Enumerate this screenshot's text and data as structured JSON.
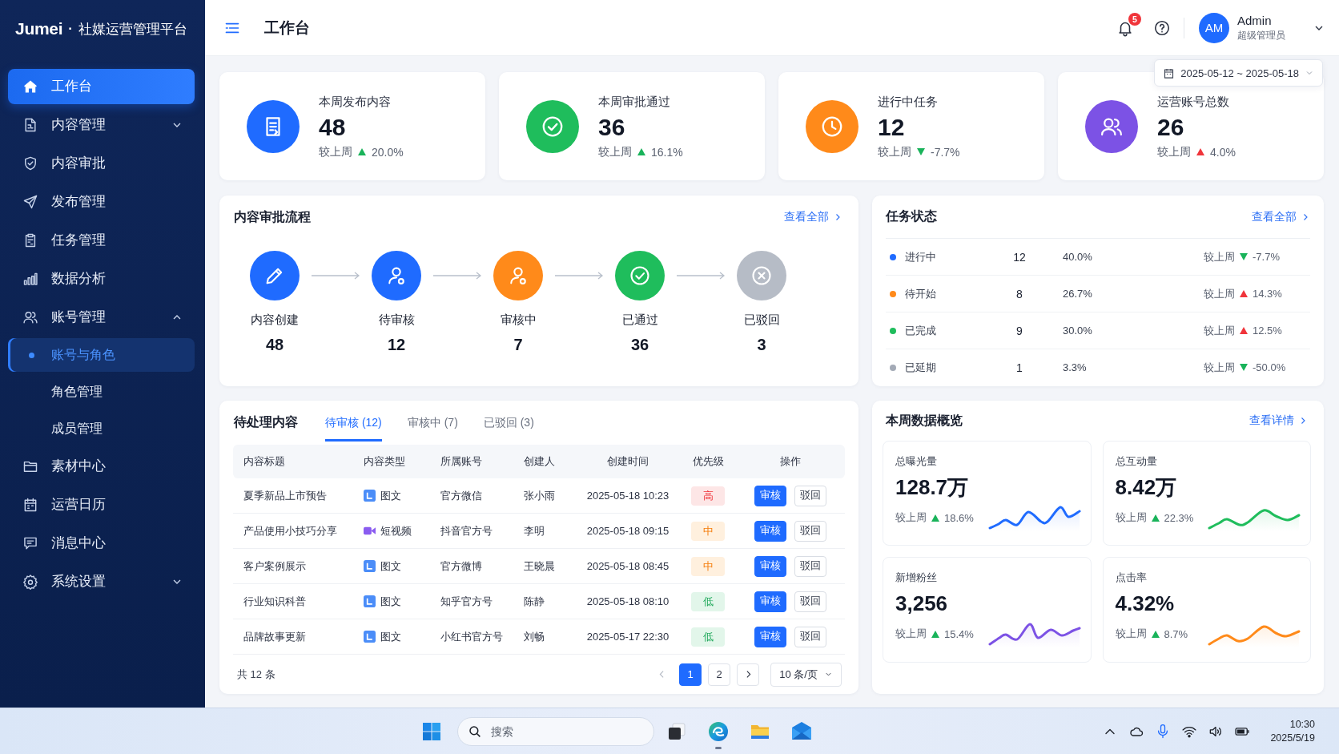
{
  "sidebar": {
    "brand": "Jumei",
    "separator": "·",
    "app_name": "社媒运营管理平台",
    "items": [
      {
        "label": "工作台",
        "selected": true
      },
      {
        "label": "内容管理",
        "selected": false,
        "expanded": false
      },
      {
        "label": "内容审批",
        "selected": false
      },
      {
        "label": "发布管理",
        "selected": false
      },
      {
        "label": "任务管理",
        "selected": false
      },
      {
        "label": "数据分析",
        "selected": false
      },
      {
        "label": "账号管理",
        "selected": false,
        "expanded": true,
        "children": [
          {
            "label": "账号与角色",
            "selected": true
          },
          {
            "label": "角色管理",
            "selected": false
          },
          {
            "label": "成员管理",
            "selected": false
          }
        ]
      },
      {
        "label": "素材中心",
        "selected": false
      },
      {
        "label": "运营日历",
        "selected": false
      },
      {
        "label": "消息中心",
        "selected": false
      },
      {
        "label": "系统设置",
        "selected": false,
        "expanded": false
      }
    ]
  },
  "header": {
    "title": "工作台",
    "notification_count": "5",
    "user": {
      "initials": "AM",
      "name": "Admin",
      "role": "超级管理员"
    }
  },
  "date_range": "2025-05-12 ~ 2025-05-18",
  "stats": [
    {
      "label": "本周发布内容",
      "value": "48",
      "compare_label": "较上周",
      "change": {
        "up": true,
        "color": "#19b35a",
        "text": "20.0%"
      },
      "color": "#1f6bff"
    },
    {
      "label": "本周审批通过",
      "value": "36",
      "compare_label": "较上周",
      "change": {
        "up": true,
        "color": "#19b35a",
        "text": "16.1%"
      },
      "color": "#1fbd5c"
    },
    {
      "label": "进行中任务",
      "value": "12",
      "compare_label": "较上周",
      "change": {
        "up": false,
        "color": "#19b35a",
        "text": "-7.7%"
      },
      "color": "#ff8a1a"
    },
    {
      "label": "运营账号总数",
      "value": "26",
      "compare_label": "较上周",
      "change": {
        "up": true,
        "color": "#f0353b",
        "text": "4.0%"
      },
      "color": "#7c52e5"
    }
  ],
  "approval_flow": {
    "title": "内容审批流程",
    "link": "查看全部",
    "steps": [
      {
        "label": "内容创建",
        "count": "48",
        "color": "#1f6bff"
      },
      {
        "label": "待审核",
        "count": "12",
        "color": "#1f6bff"
      },
      {
        "label": "审核中",
        "count": "7",
        "color": "#ff8a1a"
      },
      {
        "label": "已通过",
        "count": "36",
        "color": "#1fbd5c"
      },
      {
        "label": "已驳回",
        "count": "3",
        "color": "#b6bcc6"
      }
    ]
  },
  "task_status": {
    "title": "任务状态",
    "link": "查看全部",
    "rows": [
      {
        "label": "进行中",
        "color": "#1f6bff",
        "count": "12",
        "percent": "40.0%",
        "compare_label": "较上周",
        "change": {
          "up": false,
          "color": "#19b35a",
          "text": "-7.7%"
        }
      },
      {
        "label": "待开始",
        "color": "#ff8a1a",
        "count": "8",
        "percent": "26.7%",
        "compare_label": "较上周",
        "change": {
          "up": true,
          "color": "#f0353b",
          "text": "14.3%"
        }
      },
      {
        "label": "已完成",
        "color": "#1fbd5c",
        "count": "9",
        "percent": "30.0%",
        "compare_label": "较上周",
        "change": {
          "up": true,
          "color": "#f0353b",
          "text": "12.5%"
        }
      },
      {
        "label": "已延期",
        "color": "#a3aab6",
        "count": "1",
        "percent": "3.3%",
        "compare_label": "较上周",
        "change": {
          "up": false,
          "color": "#19b35a",
          "text": "-50.0%"
        }
      }
    ]
  },
  "pending_content": {
    "title": "待处理内容",
    "tabs": [
      {
        "label": "待审核 (12)",
        "selected": true
      },
      {
        "label": "审核中 (7)",
        "selected": false
      },
      {
        "label": "已驳回 (3)",
        "selected": false
      }
    ],
    "columns": [
      "内容标题",
      "内容类型",
      "所属账号",
      "创建人",
      "创建时间",
      "优先级",
      "操作"
    ],
    "rows": [
      {
        "title": "夏季新品上市预告",
        "type": {
          "kind": "article",
          "label": "图文"
        },
        "account": "官方微信",
        "creator": "张小雨",
        "created_at": "2025-05-18 10:23",
        "priority": {
          "label": "高",
          "kind": "high"
        },
        "actions": [
          {
            "label": "审核",
            "kind": "primary"
          },
          {
            "label": "驳回",
            "kind": "secondary"
          }
        ]
      },
      {
        "title": "产品使用小技巧分享",
        "type": {
          "kind": "video",
          "label": "短视频"
        },
        "account": "抖音官方号",
        "creator": "李明",
        "created_at": "2025-05-18 09:15",
        "priority": {
          "label": "中",
          "kind": "medium"
        },
        "actions": [
          {
            "label": "审核",
            "kind": "primary"
          },
          {
            "label": "驳回",
            "kind": "secondary"
          }
        ]
      },
      {
        "title": "客户案例展示",
        "type": {
          "kind": "article",
          "label": "图文"
        },
        "account": "官方微博",
        "creator": "王晓晨",
        "created_at": "2025-05-18 08:45",
        "priority": {
          "label": "中",
          "kind": "medium"
        },
        "actions": [
          {
            "label": "审核",
            "kind": "primary"
          },
          {
            "label": "驳回",
            "kind": "secondary"
          }
        ]
      },
      {
        "title": "行业知识科普",
        "type": {
          "kind": "article",
          "label": "图文"
        },
        "account": "知乎官方号",
        "creator": "陈静",
        "created_at": "2025-05-18 08:10",
        "priority": {
          "label": "低",
          "kind": "low"
        },
        "actions": [
          {
            "label": "审核",
            "kind": "primary"
          },
          {
            "label": "驳回",
            "kind": "secondary"
          }
        ]
      },
      {
        "title": "品牌故事更新",
        "type": {
          "kind": "article",
          "label": "图文"
        },
        "account": "小红书官方号",
        "creator": "刘畅",
        "created_at": "2025-05-17 22:30",
        "priority": {
          "label": "低",
          "kind": "low"
        },
        "actions": [
          {
            "label": "审核",
            "kind": "primary"
          },
          {
            "label": "驳回",
            "kind": "secondary"
          }
        ]
      }
    ],
    "pagination": {
      "total": "共 12 条",
      "prev_disabled": true,
      "pages": [
        {
          "label": "1",
          "selected": true
        },
        {
          "label": "2",
          "selected": false
        }
      ],
      "next_disabled": false,
      "page_size": "10 条/页"
    }
  },
  "weekly_overview": {
    "title": "本周数据概览",
    "link": "查看详情",
    "metrics": [
      {
        "label": "总曝光量",
        "value": "128.7万",
        "compare_label": "较上周",
        "change": {
          "up": true,
          "color": "#19b35a",
          "text": "18.6%"
        },
        "color": "#1f6bff"
      },
      {
        "label": "总互动量",
        "value": "8.42万",
        "compare_label": "较上周",
        "change": {
          "up": true,
          "color": "#19b35a",
          "text": "22.3%"
        },
        "color": "#1fbd5c"
      },
      {
        "label": "新增粉丝",
        "value": "3,256",
        "compare_label": "较上周",
        "change": {
          "up": true,
          "color": "#19b35a",
          "text": "15.4%"
        },
        "color": "#7c52e5"
      },
      {
        "label": "点击率",
        "value": "4.32%",
        "compare_label": "较上周",
        "change": {
          "up": true,
          "color": "#19b35a",
          "text": "8.7%"
        },
        "color": "#ff8a1a"
      }
    ]
  },
  "taskbar": {
    "search_placeholder": "搜索",
    "time": "10:30",
    "date": "2025/5/19"
  }
}
